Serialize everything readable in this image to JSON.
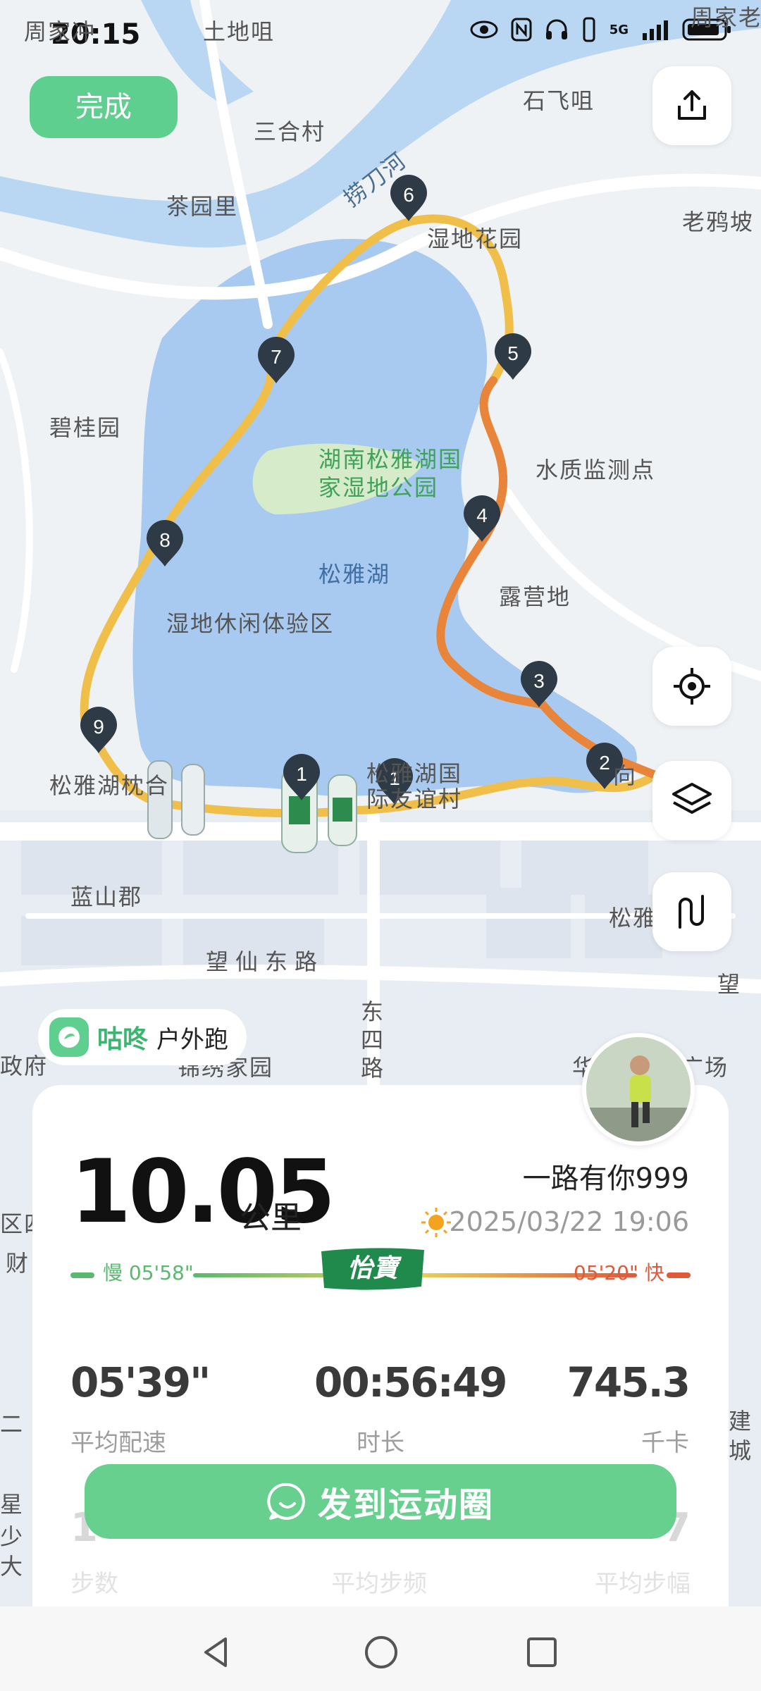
{
  "status_bar": {
    "time": "20:15",
    "network": "5G"
  },
  "top_bar": {
    "done_label": "完成",
    "share_icon": "share-icon"
  },
  "map": {
    "place_labels": [
      "周家冲",
      "土地咀",
      "三合村",
      "石飞咀",
      "周家老",
      "捞刀河",
      "茶园里",
      "湿地花园",
      "老鸦坡",
      "碧桂园",
      "水质监测点",
      "露营地",
      "湿地休闲体验区",
      "松雅湖枕合",
      "松雅湖国际友谊村",
      "向",
      "蓝山郡",
      "松雅",
      "望仙东路",
      "东四路",
      "政府",
      "锦绣家园",
      "华",
      "广场",
      "望",
      "区四",
      "财",
      "二",
      "星",
      "少",
      "大",
      "建",
      "城"
    ],
    "park_label_line1": "湖南松雅湖国",
    "park_label_line2": "家湿地公园",
    "lake_label": "松雅湖",
    "km_markers": [
      "1",
      "2",
      "3",
      "4",
      "5",
      "6",
      "7",
      "8",
      "9",
      "1"
    ],
    "route_colors": {
      "slow": "#f0bf4a",
      "fast": "#e8853a"
    },
    "side_buttons": [
      "locate-icon",
      "layers-icon",
      "route-icon"
    ]
  },
  "brand": {
    "name": "咕咚",
    "sport": "户外跑"
  },
  "summary": {
    "distance": "10.05",
    "distance_unit": "公里",
    "username": "一路有你999",
    "datetime": "2025/03/22 19:06",
    "pace_slow": "慢 05'58\"",
    "pace_fast": "05'20\" 快",
    "sponsor": "怡寶",
    "stats": [
      {
        "value": "05'39\"",
        "label": "平均配速"
      },
      {
        "value": "00:56:49",
        "label": "时长"
      },
      {
        "value": "745.3",
        "label": "千卡"
      }
    ],
    "hidden_stats": [
      {
        "value": "1",
        "label": "步数"
      },
      {
        "value": "",
        "label": "平均步频"
      },
      {
        "value": "7",
        "label": "平均步幅"
      }
    ],
    "share_label": "发到运动圈"
  },
  "colors": {
    "accent": "#5ecf8f",
    "pace_slow": "#5ab86f",
    "pace_fast": "#e05a3a"
  }
}
